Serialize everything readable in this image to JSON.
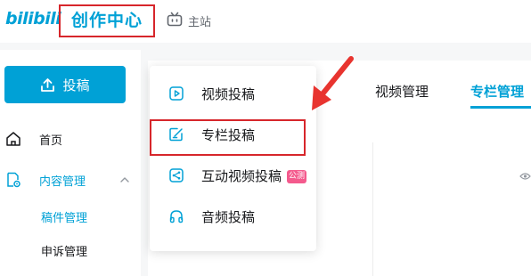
{
  "topbar": {
    "logo_text": "bilibili",
    "creator_center": "创作中心",
    "main_site": "主站"
  },
  "sidebar": {
    "upload_label": "投稿",
    "home_label": "首页",
    "content_label": "内容管理",
    "sub_items": [
      "稿件管理",
      "申诉管理"
    ]
  },
  "tabs": [
    "视频管理",
    "专栏管理"
  ],
  "dropdown": {
    "items": [
      "视频投稿",
      "专栏投稿",
      "互动视频投稿",
      "音频投稿"
    ],
    "badge": "公测"
  },
  "colors": {
    "accent": "#00a1d6",
    "highlight_red": "#d7262b",
    "badge_pink": "#f45a8d"
  }
}
